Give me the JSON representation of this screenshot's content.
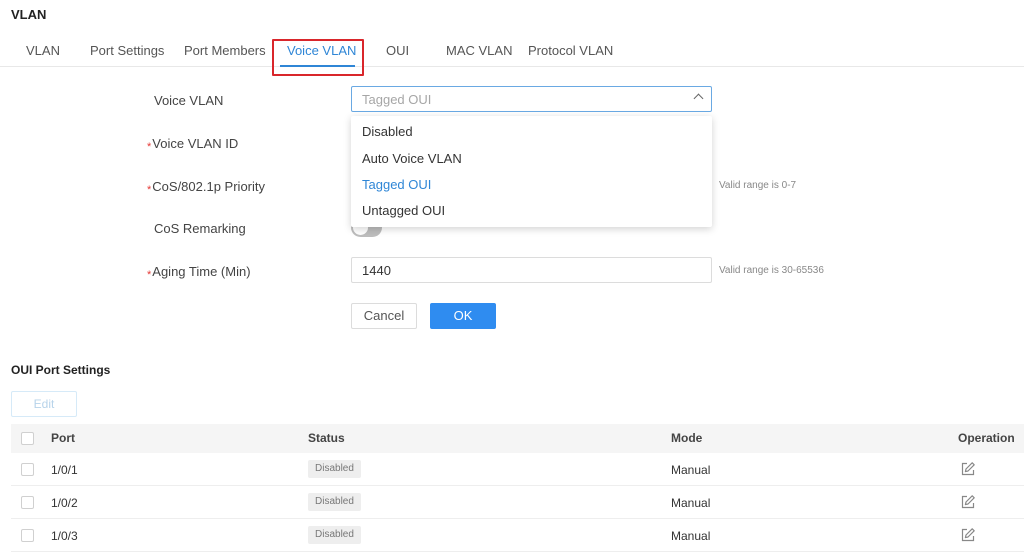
{
  "page": {
    "title": "VLAN"
  },
  "tabs": [
    {
      "label": "VLAN"
    },
    {
      "label": "Port Settings"
    },
    {
      "label": "Port Members"
    },
    {
      "label": "Voice VLAN"
    },
    {
      "label": "OUI"
    },
    {
      "label": "MAC VLAN"
    },
    {
      "label": "Protocol VLAN"
    }
  ],
  "active_tab": "Voice VLAN",
  "form": {
    "voice_vlan": {
      "label": "Voice VLAN",
      "value": "Tagged OUI",
      "options": [
        "Disabled",
        "Auto Voice VLAN",
        "Tagged OUI",
        "Untagged OUI"
      ],
      "selected": "Tagged OUI"
    },
    "voice_vlan_id": {
      "label": "Voice VLAN ID",
      "required": "*"
    },
    "cos_priority": {
      "label": "CoS/802.1p Priority",
      "required": "*",
      "hint": "Valid range is 0-7"
    },
    "cos_remarking": {
      "label": "CoS Remarking",
      "enabled": false
    },
    "aging_time": {
      "label": "Aging Time (Min)",
      "required": "*",
      "value": "1440",
      "hint": "Valid range is 30-65536"
    },
    "cancel_label": "Cancel",
    "ok_label": "OK"
  },
  "oui_port_settings": {
    "title": "OUI Port Settings",
    "edit_label": "Edit",
    "columns": [
      "Port",
      "Status",
      "Mode",
      "Operation"
    ],
    "rows": [
      {
        "port": "1/0/1",
        "status": "Disabled",
        "mode": "Manual"
      },
      {
        "port": "1/0/2",
        "status": "Disabled",
        "mode": "Manual"
      },
      {
        "port": "1/0/3",
        "status": "Disabled",
        "mode": "Manual"
      }
    ]
  },
  "colors": {
    "accent": "#2f86d6",
    "primary_button": "#2f8cf0",
    "highlight_box": "#d9262b",
    "required_mark": "#e53935"
  },
  "icons": {
    "select_toggle": "chevron-up-icon",
    "row_operation": "edit-icon"
  }
}
